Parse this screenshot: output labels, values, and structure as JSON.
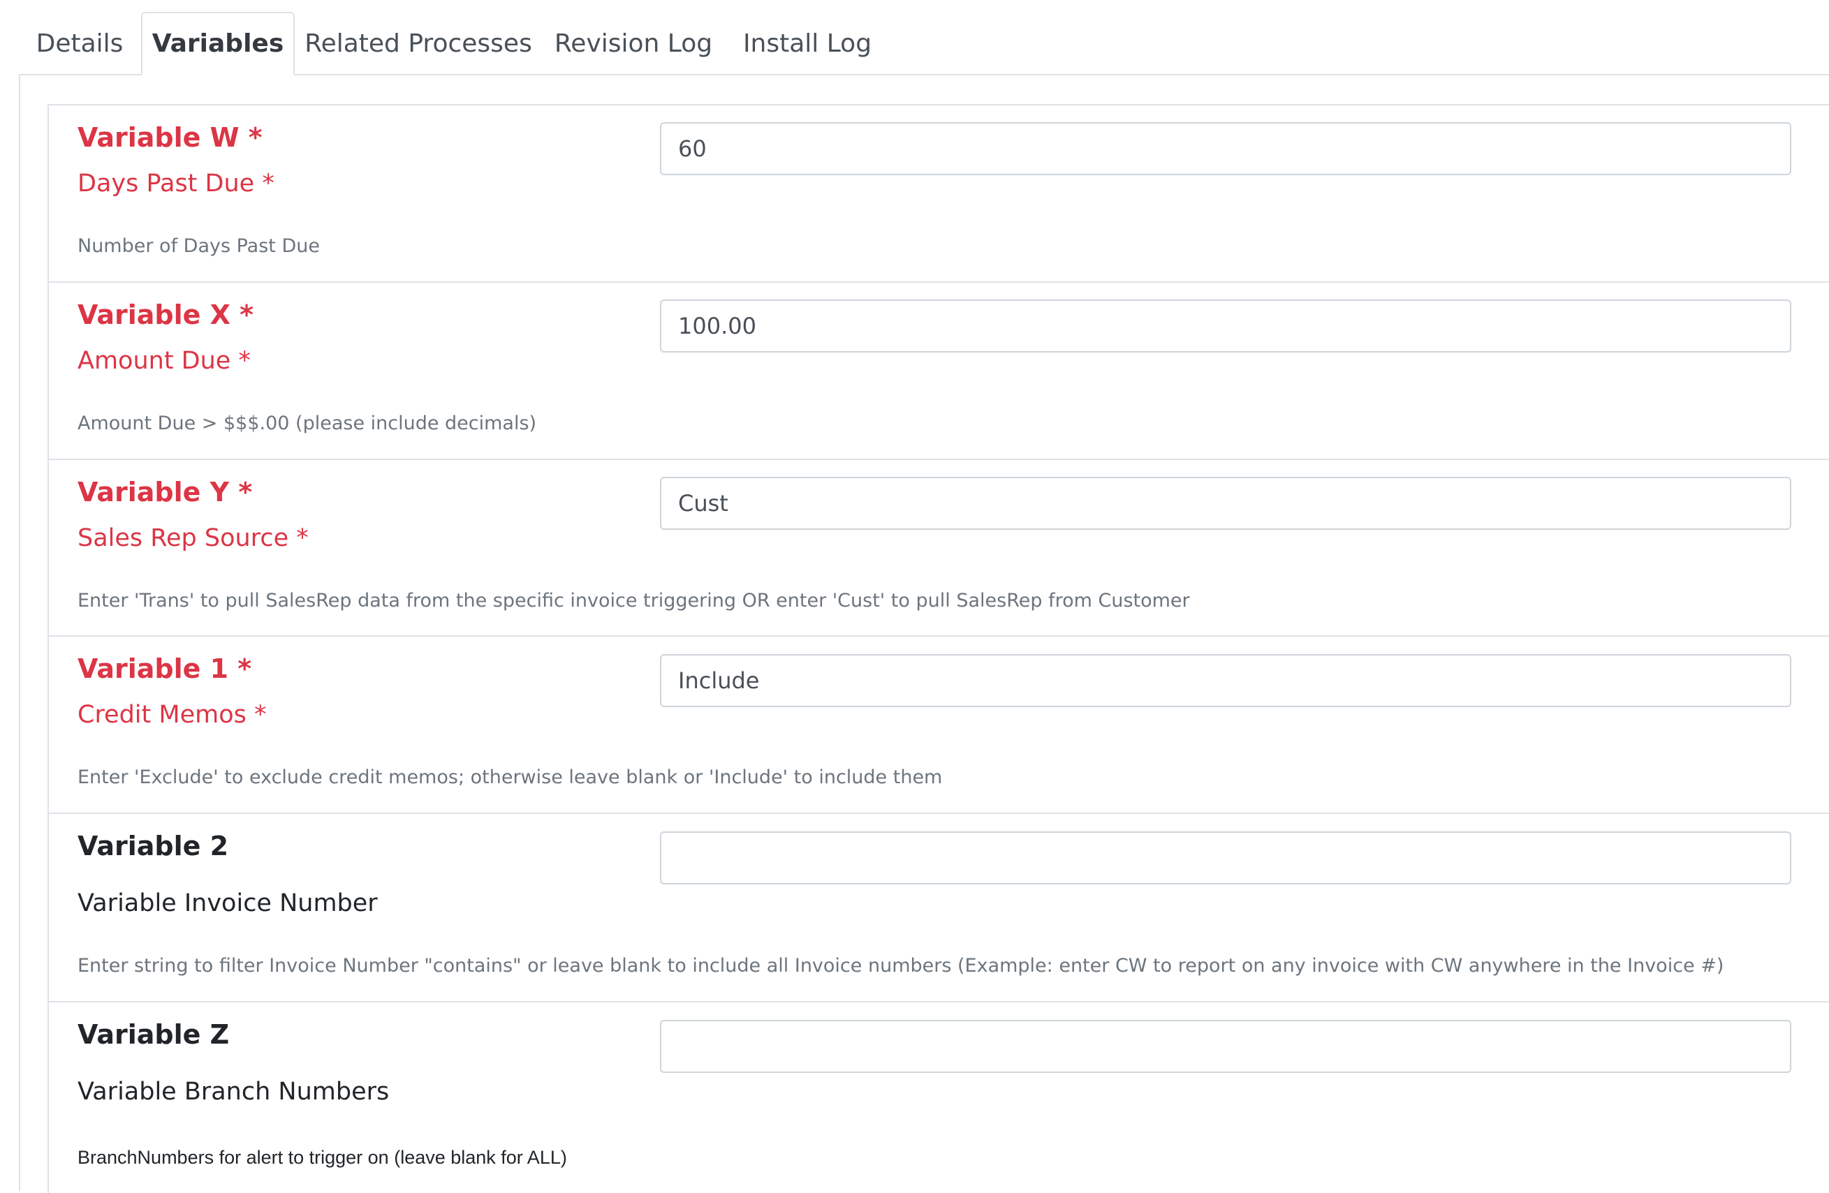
{
  "tabs": [
    {
      "label": "Details",
      "active": false
    },
    {
      "label": "Variables",
      "active": true
    },
    {
      "label": "Related Processes",
      "active": false
    },
    {
      "label": "Revision Log",
      "active": false
    },
    {
      "label": "Install Log",
      "active": false
    }
  ],
  "variables": [
    {
      "name": "Variable W *",
      "label": "Days Past Due *",
      "help": "Number of Days Past Due",
      "value": "60",
      "required": true
    },
    {
      "name": "Variable X *",
      "label": "Amount Due *",
      "help": "Amount Due > $$$.00 (please include decimals)",
      "value": "100.00",
      "required": true
    },
    {
      "name": "Variable Y *",
      "label": "Sales Rep Source *",
      "help": "Enter 'Trans' to pull SalesRep data from the specific invoice triggering OR enter 'Cust' to pull SalesRep from Customer",
      "value": "Cust",
      "required": true
    },
    {
      "name": "Variable 1 *",
      "label": "Credit Memos *",
      "help": "Enter 'Exclude' to exclude credit memos; otherwise leave blank or 'Include' to include them",
      "value": "Include",
      "required": true
    },
    {
      "name": "Variable 2",
      "label": "Variable Invoice Number",
      "help": "Enter string to filter Invoice Number \"contains\" or leave blank to include all Invoice numbers (Example: enter CW to report on any invoice with CW anywhere in the Invoice #)",
      "value": "",
      "required": false
    },
    {
      "name": "Variable Z",
      "label": "Variable Branch Numbers",
      "help": "BranchNumbers for alert to trigger on (leave blank for ALL)",
      "value": "",
      "required": false
    }
  ],
  "colors": {
    "required": "#dc3545",
    "optional": "#212529",
    "help_text": "#6c757d",
    "border": "#dee2e6"
  }
}
